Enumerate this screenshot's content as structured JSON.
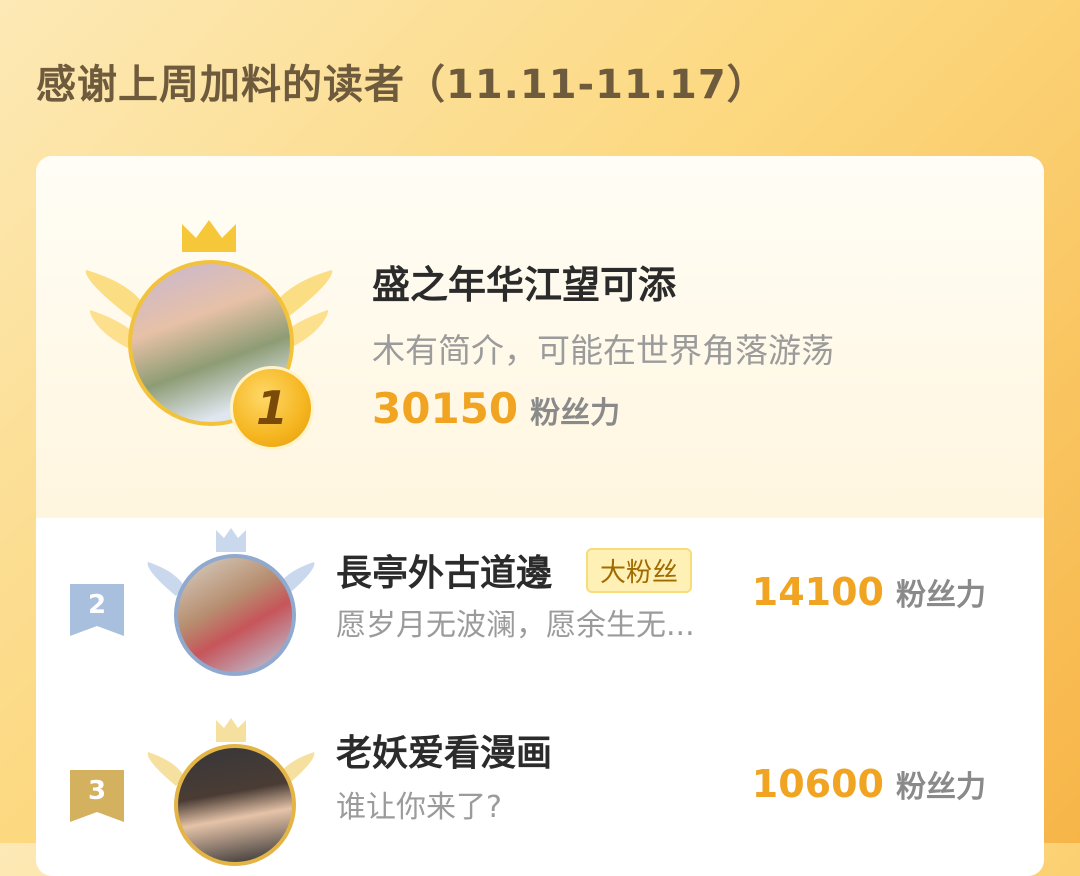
{
  "page": {
    "title": "感谢上周加料的读者（11.11-11.17）"
  },
  "colors": {
    "accent": "#f0a421",
    "gold": "#f2c23a",
    "silver": "#8fa9cf",
    "bronze": "#d4b15e"
  },
  "top_reader": {
    "rank": "1",
    "name": "盛之年华江望可添",
    "bio": "木有简介，可能在世界角落游荡",
    "score": "30150",
    "score_unit": "粉丝力",
    "icons": [
      "crown-icon",
      "wings-icon"
    ]
  },
  "readers": [
    {
      "rank": "2",
      "name": "長亭外古道邊",
      "badge": "大粉丝",
      "bio": "愿岁月无波澜，愿余生无...",
      "score": "14100",
      "score_unit": "粉丝力"
    },
    {
      "rank": "3",
      "name": "老妖爱看漫画",
      "bio": "谁让你来了?",
      "score": "10600",
      "score_unit": "粉丝力"
    }
  ]
}
